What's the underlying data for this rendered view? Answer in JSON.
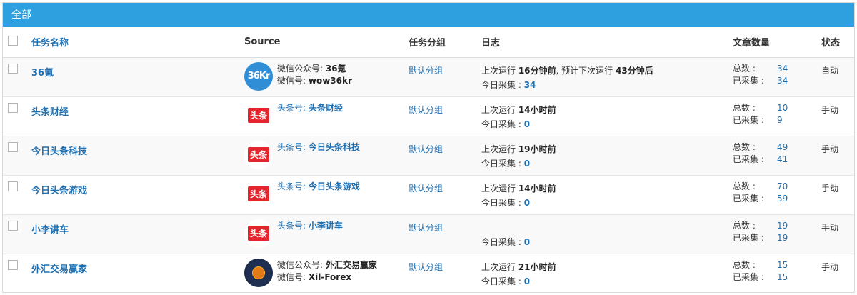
{
  "panel": {
    "title": "全部"
  },
  "columns": {
    "name": "任务名称",
    "source": "Source",
    "group": "任务分组",
    "log": "日志",
    "stats": "文章数量",
    "status": "状态"
  },
  "rows": [
    {
      "name": "36氪",
      "logo": "36kr-logo",
      "logo_text": "36Kr",
      "src_line1_label": "微信公众号: ",
      "src_line1_value": "36氪",
      "src_line2_label": "微信号: ",
      "src_line2_value": "wow36kr",
      "group": "默认分组",
      "last_run_prefix": "上次运行 ",
      "last_run": "16分钟前",
      "next_run_prefix": ", 预计下次运行 ",
      "next_run": "43分钟后",
      "today_label": "今日采集 : ",
      "today": "34",
      "total_label": "总数 :",
      "total": "34",
      "collected_label": "已采集 :",
      "collected": "34",
      "status": "自动"
    },
    {
      "name": "头条财经",
      "logo": "toutiao-logo",
      "logo_text": "头条",
      "src_line1_label": "头条号: ",
      "src_line1_value": "头条财经",
      "group": "默认分组",
      "last_run_prefix": "上次运行 ",
      "last_run": "14小时前",
      "today_label": "今日采集 : ",
      "today": "0",
      "total_label": "总数 :",
      "total": "10",
      "collected_label": "已采集 :",
      "collected": "9",
      "status": "手动"
    },
    {
      "name": "今日头条科技",
      "logo": "toutiao-logo",
      "logo_text": "头条",
      "src_line1_label": "头条号: ",
      "src_line1_value": "今日头条科技",
      "group": "默认分组",
      "last_run_prefix": "上次运行 ",
      "last_run": "19小时前",
      "today_label": "今日采集 : ",
      "today": "0",
      "total_label": "总数 :",
      "total": "49",
      "collected_label": "已采集 :",
      "collected": "41",
      "status": "手动"
    },
    {
      "name": "今日头条游戏",
      "logo": "toutiao-logo",
      "logo_text": "头条",
      "src_line1_label": "头条号: ",
      "src_line1_value": "今日头条游戏",
      "group": "默认分组",
      "last_run_prefix": "上次运行 ",
      "last_run": "14小时前",
      "today_label": "今日采集 : ",
      "today": "0",
      "total_label": "总数 :",
      "total": "70",
      "collected_label": "已采集 :",
      "collected": "59",
      "status": "手动"
    },
    {
      "name": "小李讲车",
      "logo": "toutiao-logo",
      "logo_text": "头条",
      "src_line1_label": "头条号: ",
      "src_line1_value": "小李讲车",
      "group": "默认分组",
      "today_label": "今日采集 : ",
      "today": "0",
      "total_label": "总数 :",
      "total": "19",
      "collected_label": "已采集 :",
      "collected": "19",
      "status": "手动"
    },
    {
      "name": "外汇交易赢家",
      "logo": "forex-logo",
      "src_line1_label": "微信公众号: ",
      "src_line1_value": "外汇交易赢家",
      "src_line2_label": "微信号: ",
      "src_line2_value": "Xil-Forex",
      "group": "默认分组",
      "last_run_prefix": "上次运行 ",
      "last_run": "21小时前",
      "today_label": "今日采集 : ",
      "today": "0",
      "total_label": "总数 :",
      "total": "15",
      "collected_label": "已采集 :",
      "collected": "15",
      "status": "手动"
    }
  ]
}
